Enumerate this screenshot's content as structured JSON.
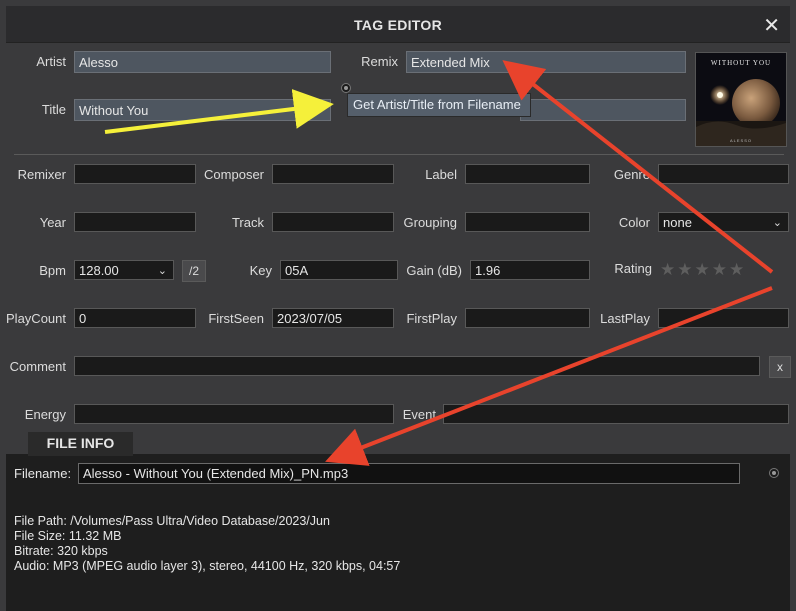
{
  "window": {
    "title": "TAG EDITOR",
    "close_glyph": "✕"
  },
  "fields": {
    "artist": {
      "label": "Artist",
      "value": "Alesso"
    },
    "remix": {
      "label": "Remix",
      "value": "Extended Mix"
    },
    "title": {
      "label": "Title",
      "value": "Without You"
    },
    "remixer": {
      "label": "Remixer",
      "value": ""
    },
    "composer": {
      "label": "Composer",
      "value": ""
    },
    "label": {
      "label": "Label",
      "value": ""
    },
    "genre": {
      "label": "Genre",
      "value": ""
    },
    "year": {
      "label": "Year",
      "value": ""
    },
    "track": {
      "label": "Track",
      "value": ""
    },
    "grouping": {
      "label": "Grouping",
      "value": ""
    },
    "color": {
      "label": "Color",
      "value": "none"
    },
    "bpm": {
      "label": "Bpm",
      "value": "128.00",
      "half_button": "/2"
    },
    "key": {
      "label": "Key",
      "value": "05A"
    },
    "gain": {
      "label": "Gain (dB)",
      "value": "1.96"
    },
    "rating": {
      "label": "Rating",
      "stars": "★★★★★",
      "value": 0,
      "max": 5
    },
    "playcount": {
      "label": "PlayCount",
      "value": "0"
    },
    "firstseen": {
      "label": "FirstSeen",
      "value": "2023/07/05"
    },
    "firstplay": {
      "label": "FirstPlay",
      "value": ""
    },
    "lastplay": {
      "label": "LastPlay",
      "value": ""
    },
    "comment": {
      "label": "Comment",
      "value": "",
      "clear_button": "x"
    },
    "energy": {
      "label": "Energy",
      "value": ""
    },
    "event": {
      "label": "Event",
      "value": ""
    }
  },
  "popup_menu": {
    "item": "Get Artist/Title from Filename"
  },
  "cover_art": {
    "text": "WITHOUT YOU",
    "artist_mark": "ALESSO"
  },
  "file_info": {
    "tab_label": "FILE INFO",
    "filename_label": "Filename:",
    "filename_value": "Alesso - Without You (Extended Mix)_PN.mp3",
    "path_line": "File Path: /Volumes/Pass Ultra/Video Database/2023/Jun",
    "size_line": "File Size: 11.32 MB",
    "bitrate_line": "Bitrate: 320 kbps",
    "audio_line": "Audio: MP3 (MPEG audio layer 3), stereo, 44100 Hz, 320 kbps, 04:57"
  },
  "colors": {
    "background": "#3a3a3c",
    "field_bg": "#1a1a1a",
    "filled_field_bg": "#4e5660",
    "arrow_red": "#e8432c",
    "arrow_yellow": "#f5f03a"
  }
}
